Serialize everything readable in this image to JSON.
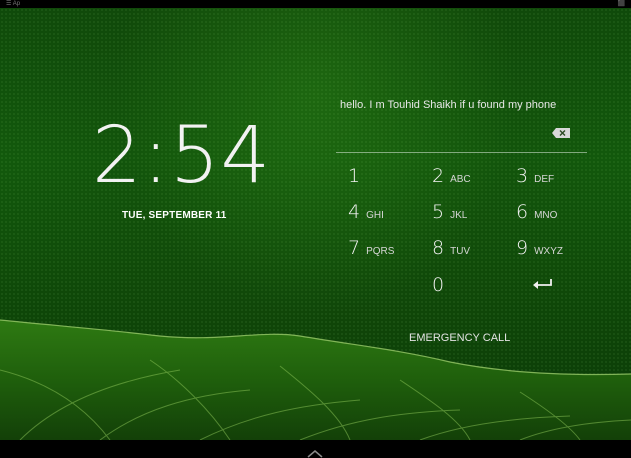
{
  "status_bar": {
    "left_text": "☰  Ap",
    "right_text": "⬛"
  },
  "lock_screen": {
    "time": "2:54",
    "date": "TUE, SEPTEMBER 11",
    "owner_info": "hello. I m Touhid Shaikh  if u found my phone"
  },
  "keypad": {
    "keys": [
      {
        "digit": "1",
        "letters": ""
      },
      {
        "digit": "2",
        "letters": "ABC"
      },
      {
        "digit": "3",
        "letters": "DEF"
      },
      {
        "digit": "4",
        "letters": "GHI"
      },
      {
        "digit": "5",
        "letters": "JKL"
      },
      {
        "digit": "6",
        "letters": "MNO"
      },
      {
        "digit": "7",
        "letters": "PQRS"
      },
      {
        "digit": "8",
        "letters": "TUV"
      },
      {
        "digit": "9",
        "letters": "WXYZ"
      },
      {
        "digit": "0",
        "letters": ""
      }
    ],
    "backspace_icon": "backspace-icon",
    "enter_icon": "enter-icon"
  },
  "emergency_call": "EMERGENCY CALL",
  "colors": {
    "wallpaper_green": "#125a0c",
    "text": "#f2f2f2"
  }
}
